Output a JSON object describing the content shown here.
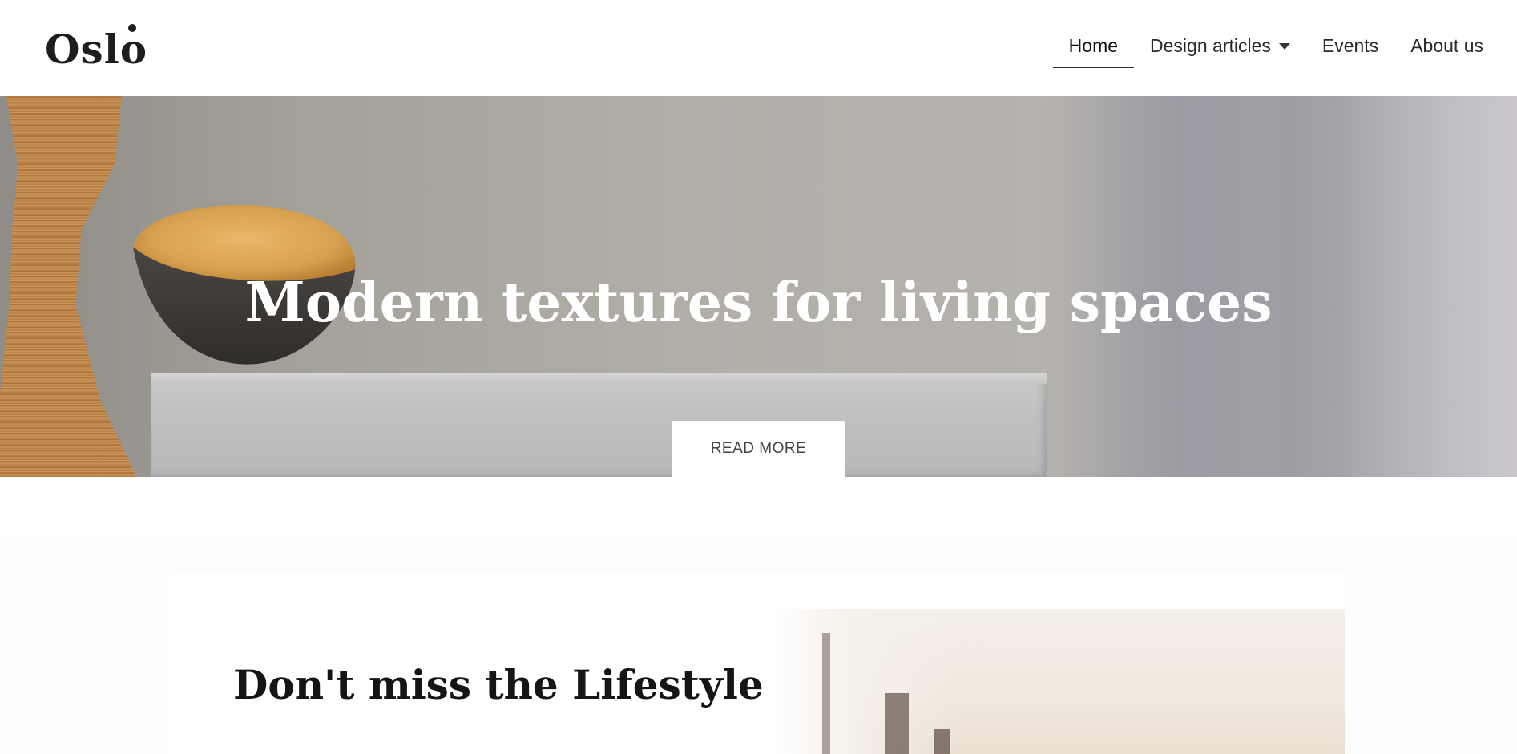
{
  "header": {
    "logo": "Oslo",
    "nav": [
      {
        "label": "Home",
        "active": true
      },
      {
        "label": "Design articles",
        "has_dropdown": true
      },
      {
        "label": "Events"
      },
      {
        "label": "About us"
      }
    ]
  },
  "hero": {
    "title": "Modern textures for living spaces",
    "button_label": "READ MORE"
  },
  "section": {
    "title": "Don't miss the Lifestyle"
  },
  "colors": {
    "header_bg": "#ffffff",
    "hero_text": "#ffffff",
    "button_bg": "#ffffff",
    "text_dark": "#151515"
  }
}
